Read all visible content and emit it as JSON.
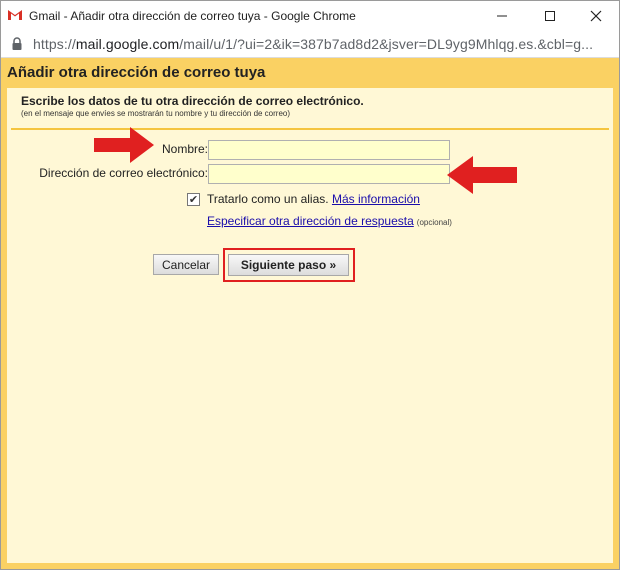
{
  "window": {
    "title": "Gmail - Añadir otra dirección de correo tuya - Google Chrome",
    "url_scheme": "https://",
    "url_host": "mail.google.com",
    "url_path": "/mail/u/1/?ui=2&ik=387b7ad8d2&jsver=DL9yg9Mhlqg.es.&cbl=g..."
  },
  "dialog": {
    "title": "Añadir otra dirección de correo tuya",
    "subtitle": "Escribe los datos de tu otra dirección de correo electrónico.",
    "note": "(en el mensaje que envíes se mostrarán tu nombre y tu dirección de correo)"
  },
  "form": {
    "name_label": "Nombre:",
    "name_value": "",
    "email_label": "Dirección de correo electrónico:",
    "email_value": "",
    "alias_checked": true,
    "alias_label": "Tratarlo como un alias.",
    "more_info_link": "Más información",
    "reply_to_link": "Especificar otra dirección de respuesta",
    "optional": "(opcional)"
  },
  "buttons": {
    "cancel": "Cancelar",
    "next": "Siguiente paso »"
  },
  "annotations": {
    "arrow_color": "#e02020"
  },
  "colors": {
    "header_bg": "#fad163",
    "panel_bg": "#fff8d6",
    "input_bg": "#ffffcc"
  }
}
